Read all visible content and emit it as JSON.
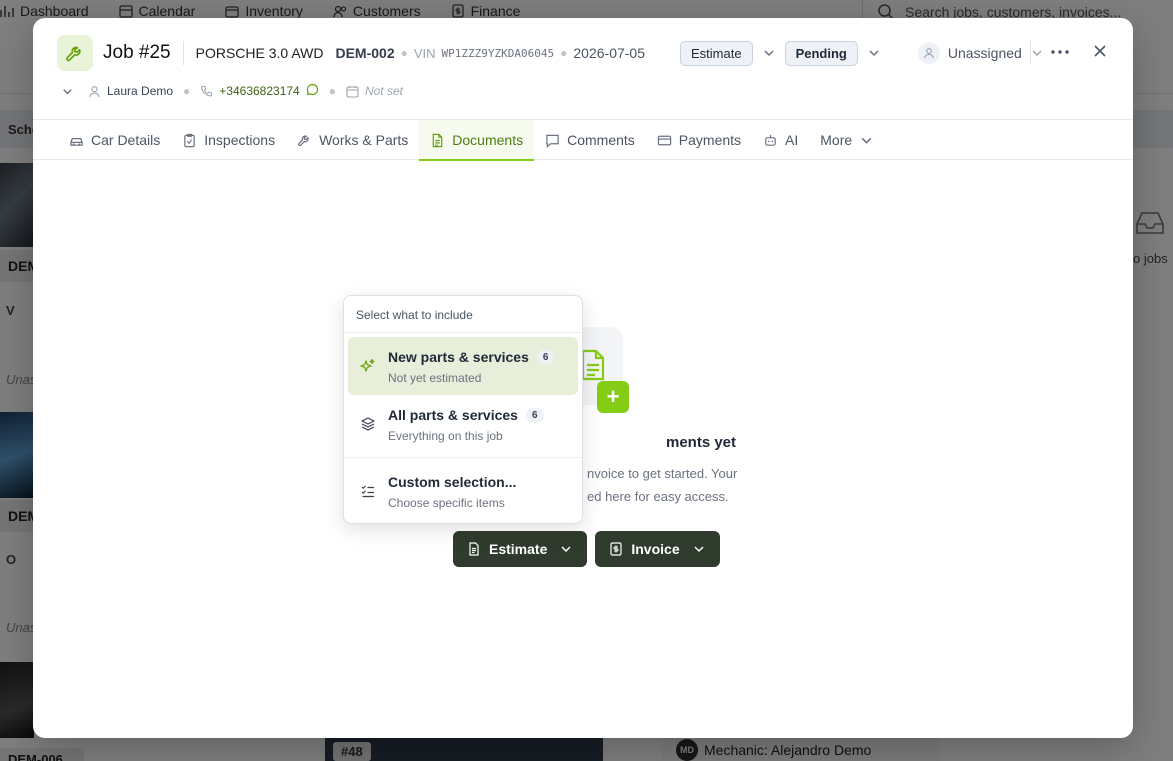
{
  "bg": {
    "nav": [
      "Dashboard",
      "Calendar",
      "Inventory",
      "Customers",
      "Finance"
    ],
    "search_placeholder": "Search jobs, customers, invoices...",
    "schedule_label": "Sche",
    "plate1": "DEM",
    "plate2": "DEM",
    "plate3": "DEM-006",
    "row_a": "V",
    "row_b": "O",
    "unas1": "Unas",
    "unas2": "Unas",
    "right_empty": "o jobs",
    "bottom_tag": "#48",
    "mechanic": "Mechanic: Alejandro Demo",
    "mechanic_initials": "MD"
  },
  "header": {
    "job_title": "Job #25",
    "car_name": "PORSCHE 3.0 AWD",
    "plate": "DEM-002",
    "vin_label": "VIN",
    "vin": "WP1ZZZ9YZKDA06045",
    "date": "2026-07-05",
    "type_pill": "Estimate",
    "status_pill": "Pending",
    "assignee": "Unassigned",
    "customer": "Laura Demo",
    "phone": "+34636823174",
    "due": "Not set"
  },
  "tabs": [
    {
      "label": "Car Details"
    },
    {
      "label": "Inspections"
    },
    {
      "label": "Works & Parts"
    },
    {
      "label": "Documents"
    },
    {
      "label": "Comments"
    },
    {
      "label": "Payments"
    },
    {
      "label": "AI"
    },
    {
      "label": "More"
    }
  ],
  "empty": {
    "title": "ments yet",
    "desc_line1": "nvoice to get started. Your",
    "desc_line2": "ed here for easy access."
  },
  "actions": {
    "estimate": "Estimate",
    "invoice": "Invoice"
  },
  "dropdown": {
    "heading": "Select what to include",
    "items": [
      {
        "title": "New parts & services",
        "count": "6",
        "sub": "Not yet estimated"
      },
      {
        "title": "All parts & services",
        "count": "6",
        "sub": "Everything on this job"
      },
      {
        "title": "Custom selection...",
        "sub": "Choose specific items"
      }
    ]
  },
  "colors": {
    "accent": "#84cc16",
    "accent_text": "#4d7c0f",
    "button_dark": "#2f3b2d"
  }
}
